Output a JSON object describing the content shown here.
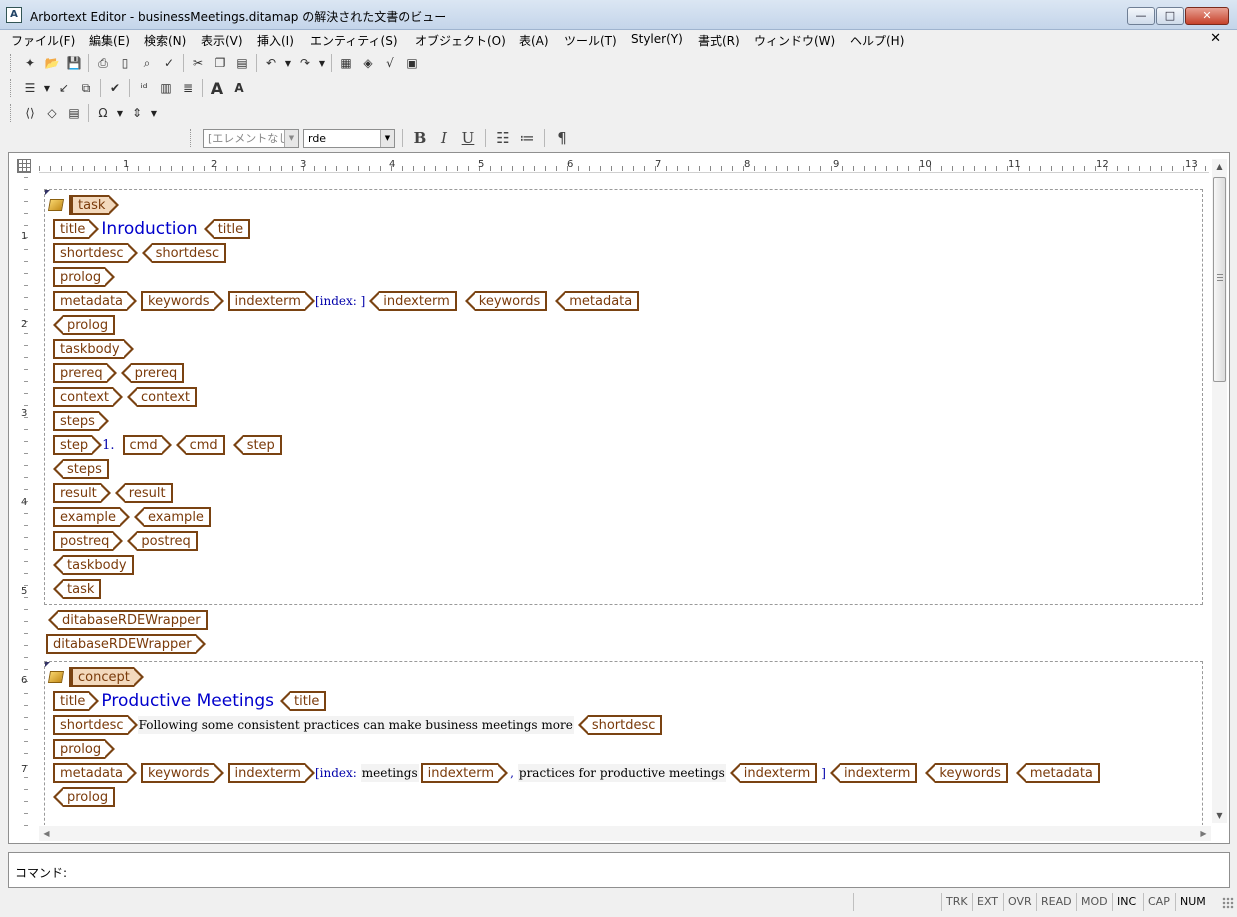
{
  "window": {
    "title": "Arbortext Editor - businessMeetings.ditamap の解決された文書のビュー",
    "app_icon": "A",
    "minimize": "—",
    "maximize": "□",
    "close": "✕"
  },
  "menu": [
    "ファイル(F)",
    "編集(E)",
    "検索(N)",
    "表示(V)",
    "挿入(I)",
    "エンティティ(S)",
    "オブジェクト(O)",
    "表(A)",
    "ツール(T)",
    "Styler(Y)",
    "書式(R)",
    "ウィンドウ(W)",
    "ヘルプ(H)"
  ],
  "mdi_close": "✕",
  "toolbar1_icons": [
    "new-icon",
    "open-icon",
    "save-icon",
    "print-icon",
    "print-preview-icon",
    "find-icon",
    "spellcheck-icon",
    "cut-icon",
    "copy-icon",
    "paste-icon",
    "undo-icon",
    "redo-icon",
    "table-icon",
    "graphic-icon",
    "equation-icon",
    "compose-icon"
  ],
  "format_bar": {
    "element_combo": "[エレメントなし",
    "style_combo": "rde",
    "bold": "B",
    "italic": "I",
    "underline": "U",
    "pilcrow": "¶"
  },
  "ruler": {
    "labels": [
      "1",
      "2",
      "3",
      "4",
      "5",
      "6",
      "7",
      "8",
      "9",
      "10",
      "11",
      "12",
      "13"
    ]
  },
  "vruler": {
    "labels": [
      "1",
      "2",
      "3",
      "4",
      "5",
      "6",
      "7"
    ]
  },
  "document": {
    "task": {
      "root_tag": "task",
      "title_tag": "title",
      "title_text": "Inroduction",
      "shortdesc_tag": "shortdesc",
      "prolog_tag": "prolog",
      "metadata_tag": "metadata",
      "keywords_tag": "keywords",
      "indexterm_tag": "indexterm",
      "index_marker": "[index: ]",
      "taskbody_tag": "taskbody",
      "prereq_tag": "prereq",
      "context_tag": "context",
      "steps_tag": "steps",
      "step_tag": "step",
      "step_number": "1.",
      "cmd_tag": "cmd",
      "result_tag": "result",
      "example_tag": "example",
      "postreq_tag": "postreq"
    },
    "wrapper_tag": "ditabaseRDEWrapper",
    "concept": {
      "root_tag": "concept",
      "title_tag": "title",
      "title_text": "Productive Meetings",
      "shortdesc_tag": "shortdesc",
      "shortdesc_text": "Following some consistent practices can make business meetings more",
      "prolog_tag": "prolog",
      "metadata_tag": "metadata",
      "keywords_tag": "keywords",
      "indexterm_tag": "indexterm",
      "index_open": "[index:",
      "index_term1": "meetings",
      "comma": ",",
      "index_term2": "practices for productive meetings",
      "index_close": "]"
    }
  },
  "command": {
    "label": "コマンド:"
  },
  "status": [
    "TRK",
    "EXT",
    "OVR",
    "READ",
    "MOD",
    "INC",
    "CAP",
    "NUM"
  ]
}
